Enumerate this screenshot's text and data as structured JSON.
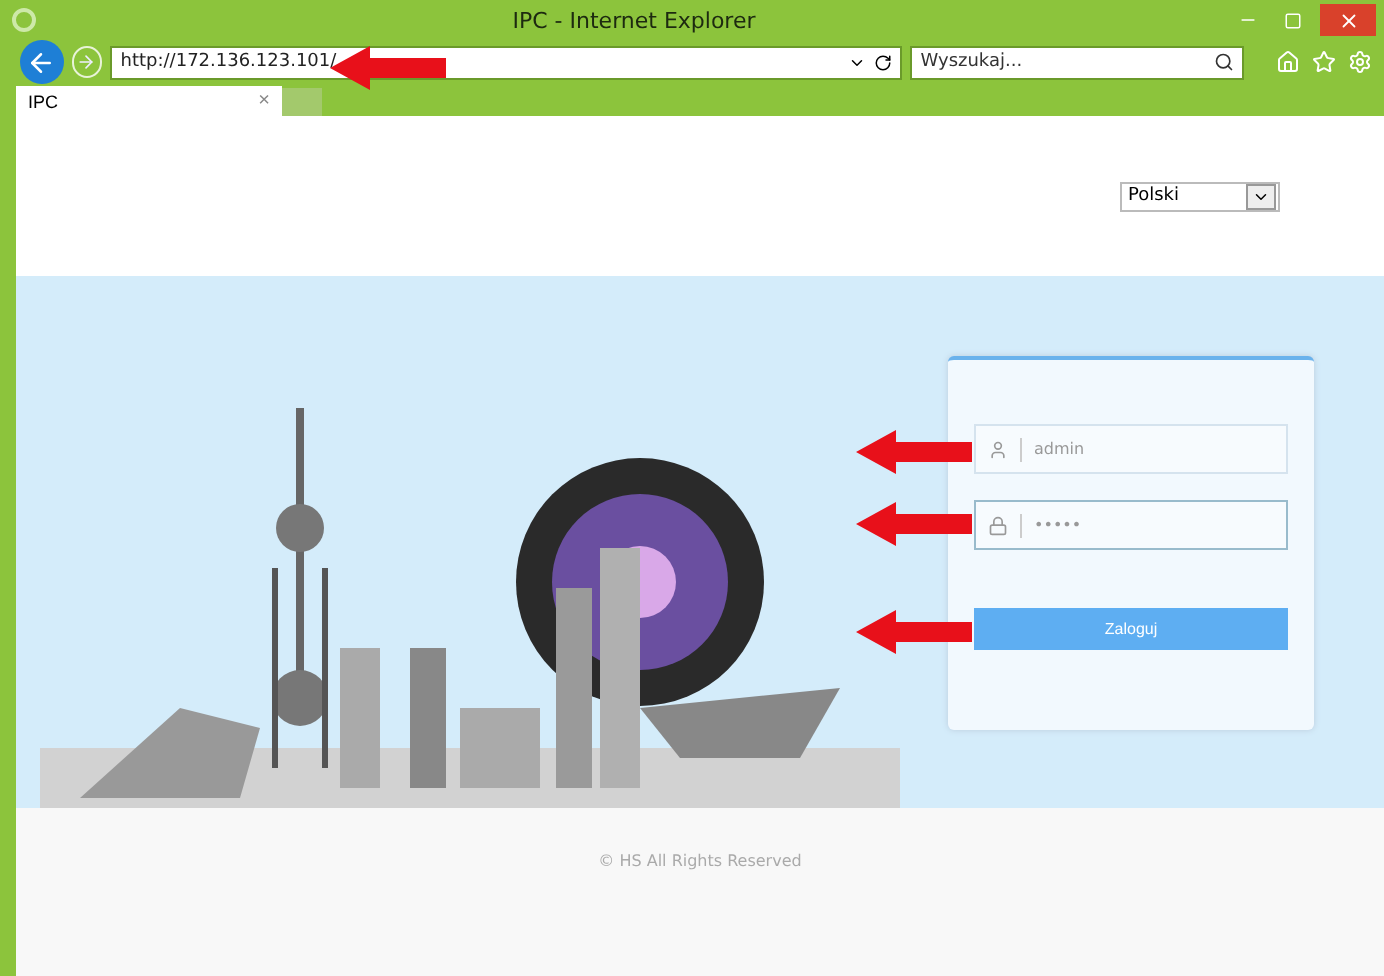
{
  "window": {
    "title": "IPC - Internet Explorer"
  },
  "address_bar": {
    "url": "http://172.136.123.101/"
  },
  "search": {
    "placeholder": "Wyszukaj..."
  },
  "tabs": [
    {
      "label": "IPC",
      "selected": true,
      "close": "×"
    }
  ],
  "language": {
    "value": "Polski"
  },
  "login": {
    "username": "admin",
    "password": "•••••",
    "button": "Zaloguj"
  },
  "footer": "© HS  All Rights Reserved"
}
